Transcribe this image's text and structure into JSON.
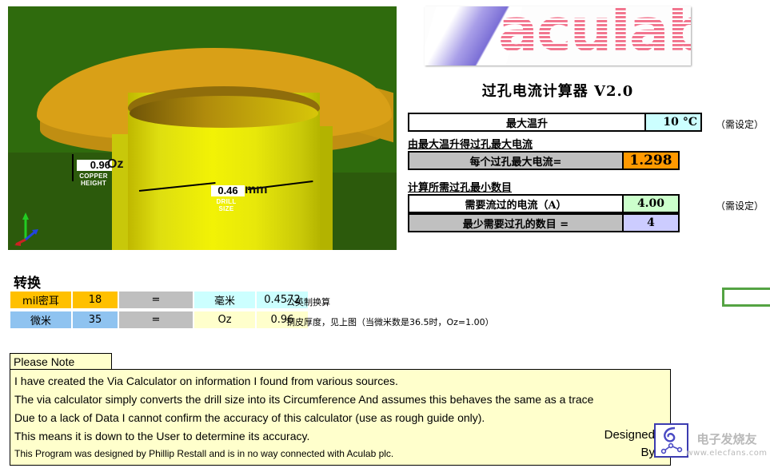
{
  "app_title": "过孔电流计算器 V2.0",
  "brand": {
    "logo_text": "aculab",
    "logo_accent": "#f2768f"
  },
  "render": {
    "copper_value": "0.96",
    "copper_unit": "Oz",
    "copper_caption": "COPPER\nHEIGHT",
    "drill_value": "0.46",
    "drill_unit": "mm",
    "drill_caption": "DRILL\nSIZE"
  },
  "calc": {
    "temp_rise": {
      "label": "最大温升",
      "value": "10",
      "unit": "°C",
      "note": "（需设定）",
      "value_color": "#ccffff"
    },
    "section_max_current": "由最大温升得过孔最大电流",
    "max_current_per_via": {
      "label": "每个过孔最大电流=",
      "value": "1.298",
      "value_color": "#ff9900"
    },
    "section_min_vias": "计算所需过孔最小数目",
    "required_current": {
      "label": "需要流过的电流（A）",
      "value": "4.00",
      "note": "（需设定）",
      "value_color": "#ccffcc"
    },
    "min_via_count": {
      "label": "最少需要过孔的数目 =",
      "value": "4",
      "value_color": "#ccccff"
    }
  },
  "conversion": {
    "title": "转换",
    "rows": [
      {
        "from_unit": "mil密耳",
        "from_value": "18",
        "equals": "=",
        "to_unit": "毫米",
        "to_value": "0.4572",
        "note": "公英制换算"
      },
      {
        "from_unit": "微米",
        "from_value": "35",
        "equals": "=",
        "to_unit": "Oz",
        "to_value": "0.96",
        "note": "铜皮厚度，见上图（当微米数是36.5时，Oz=1.00）"
      }
    ]
  },
  "note": {
    "tab_label": "Please Note",
    "lines": [
      "I have created the Via Calculator on information I found from various sources.",
      "The via calculator simply converts the drill size into its  Circumference And assumes this behaves the same as a trace",
      "Due to a lack of Data I cannot confirm the accuracy of this calculator (use as rough guide only).",
      "This means it is down to the User to determine its accuracy."
    ],
    "footer": "This Program was designed by Phillip Restall and is in no way connected with Aculab plc.",
    "designed_by_line1": "Designed",
    "designed_by_line2": "By"
  },
  "watermark": {
    "text": "电子发烧友",
    "url": "www.elecfans.com"
  }
}
